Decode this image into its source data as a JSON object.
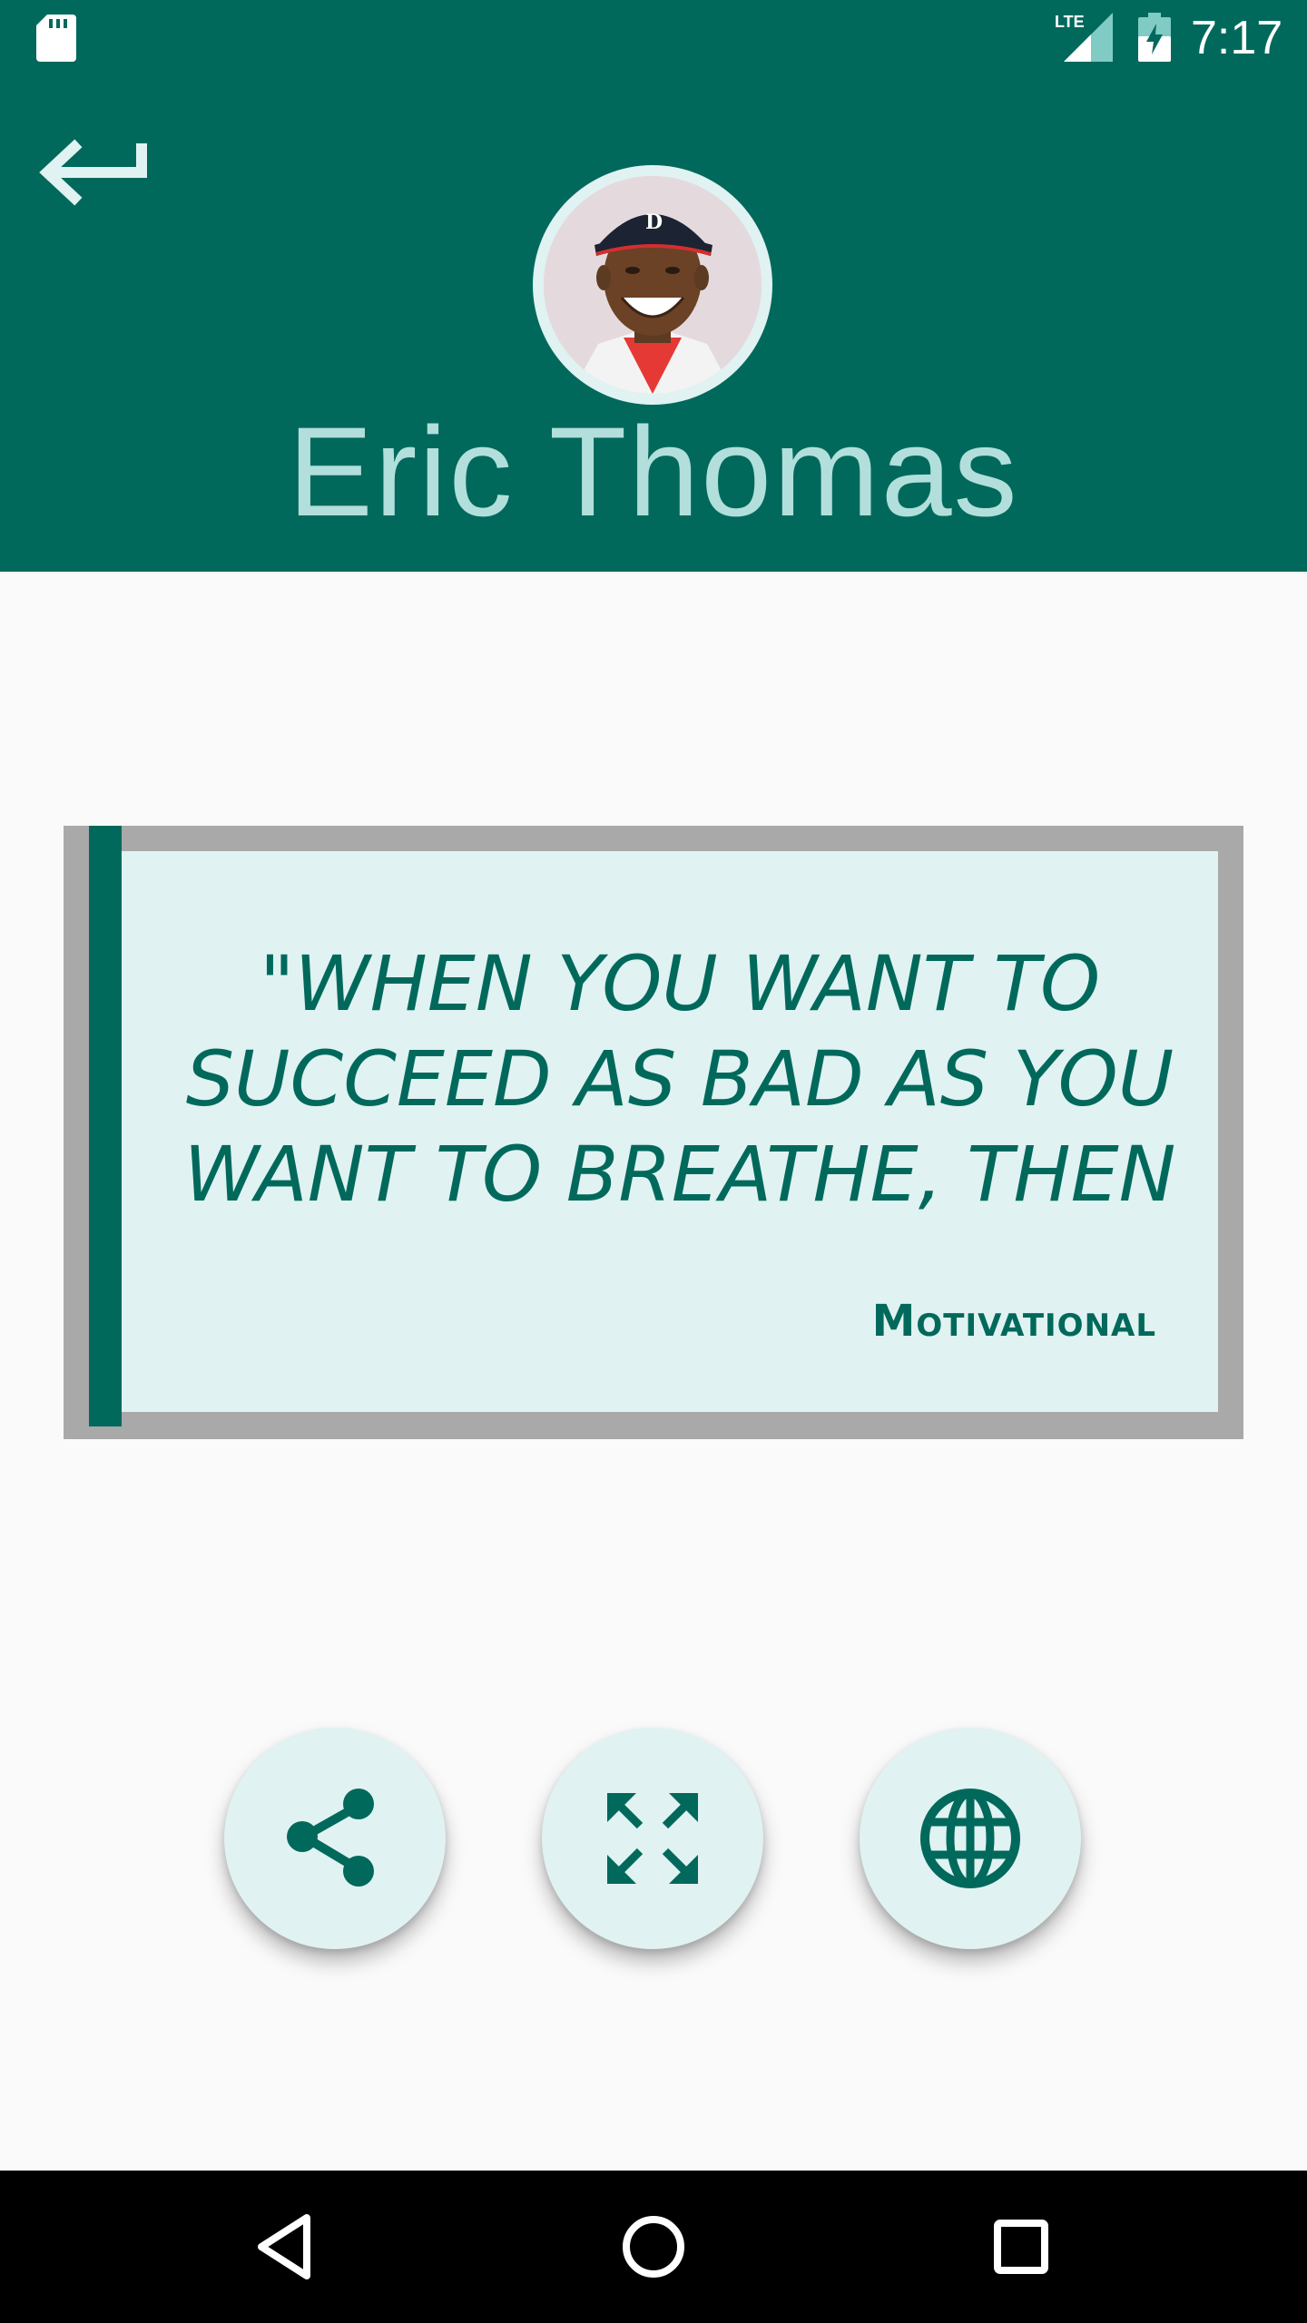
{
  "status_bar": {
    "time": "7:17",
    "network_label": "LTE",
    "icons": [
      "sd-card-icon",
      "lte-signal-icon",
      "battery-charging-icon"
    ]
  },
  "header": {
    "back_icon": "back-arrow-icon",
    "person_name": "Eric Thomas",
    "avatar": "author-portrait"
  },
  "quote": {
    "text": "\"WHEN YOU WANT TO SUCCEED AS BAD AS YOU WANT TO BREATHE, THEN",
    "category": "Motivational"
  },
  "actions": [
    {
      "name": "share",
      "icon": "share-icon"
    },
    {
      "name": "fullscreen",
      "icon": "expand-icon"
    },
    {
      "name": "web",
      "icon": "globe-icon"
    }
  ],
  "navigation": {
    "items": [
      "back-triangle-icon",
      "home-circle-icon",
      "recents-square-icon"
    ]
  },
  "colors": {
    "primary": "#00695c",
    "primary_light": "#e0f2f1",
    "name_text": "#b2dfdb",
    "card_border": "#a9a9a9",
    "background": "#fafafa"
  }
}
